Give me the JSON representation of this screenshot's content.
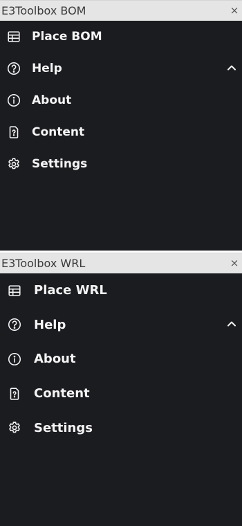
{
  "panels": [
    {
      "title": "E3Toolbox BOM",
      "close": "×",
      "items": [
        {
          "label": "Place BOM",
          "icon": "table-icon"
        },
        {
          "label": "Help",
          "icon": "help-circle-icon",
          "expanded": true
        },
        {
          "label": "About",
          "icon": "info-circle-icon"
        },
        {
          "label": "Content",
          "icon": "file-question-icon"
        },
        {
          "label": "Settings",
          "icon": "gear-icon"
        }
      ]
    },
    {
      "title": "E3Toolbox WRL",
      "close": "×",
      "items": [
        {
          "label": "Place WRL",
          "icon": "table-icon"
        },
        {
          "label": "Help",
          "icon": "help-circle-icon",
          "expanded": true
        },
        {
          "label": "About",
          "icon": "info-circle-icon"
        },
        {
          "label": "Content",
          "icon": "file-question-icon"
        },
        {
          "label": "Settings",
          "icon": "gear-icon"
        }
      ]
    }
  ],
  "colors": {
    "panel_bg": "#1b1c20",
    "titlebar_bg": "#e5e5e5",
    "text": "#f4f4f4"
  }
}
